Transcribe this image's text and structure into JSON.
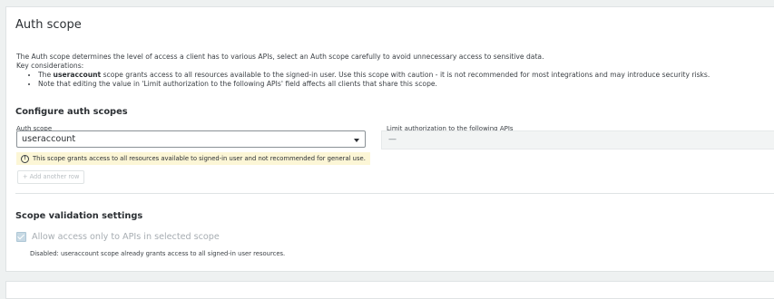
{
  "panel": {
    "title": "Auth scope",
    "description": "The Auth scope determines the level of access a client has to various APIs, select an Auth scope carefully to avoid unnecessary access to sensitive data.",
    "key_considerations_label": "Key considerations:",
    "bullet1_prefix": "The ",
    "bullet1_bold": "useraccount",
    "bullet1_rest": " scope grants access to all resources available to the signed-in user. Use this scope with caution - it is not recommended for most integrations and may introduce security risks.",
    "bullet2": "Note that editing the value in 'Limit authorization to the following APIs' field affects all clients that share this scope."
  },
  "configure": {
    "heading": "Configure auth scopes",
    "auth_scope_label": "Auth scope",
    "auth_scope_value": "useraccount",
    "limit_label": "Limit authorization to the following APIs",
    "limit_value": "—",
    "warning": "This scope grants access to all resources available to signed-in user and not recommended for general use.",
    "add_row_label": "+ Add another row"
  },
  "validation": {
    "heading": "Scope validation settings",
    "checkbox_label": "Allow access only to APIs in selected scope",
    "checkbox_checked": true,
    "checkbox_disabled": true,
    "help_text": "Disabled: useraccount scope already grants access to all signed-in user resources."
  },
  "colors": {
    "background": "#eef1f1",
    "card": "#ffffff",
    "warning_bg": "#fcf6d6",
    "checkbox_disabled": "#c7d9e4"
  }
}
